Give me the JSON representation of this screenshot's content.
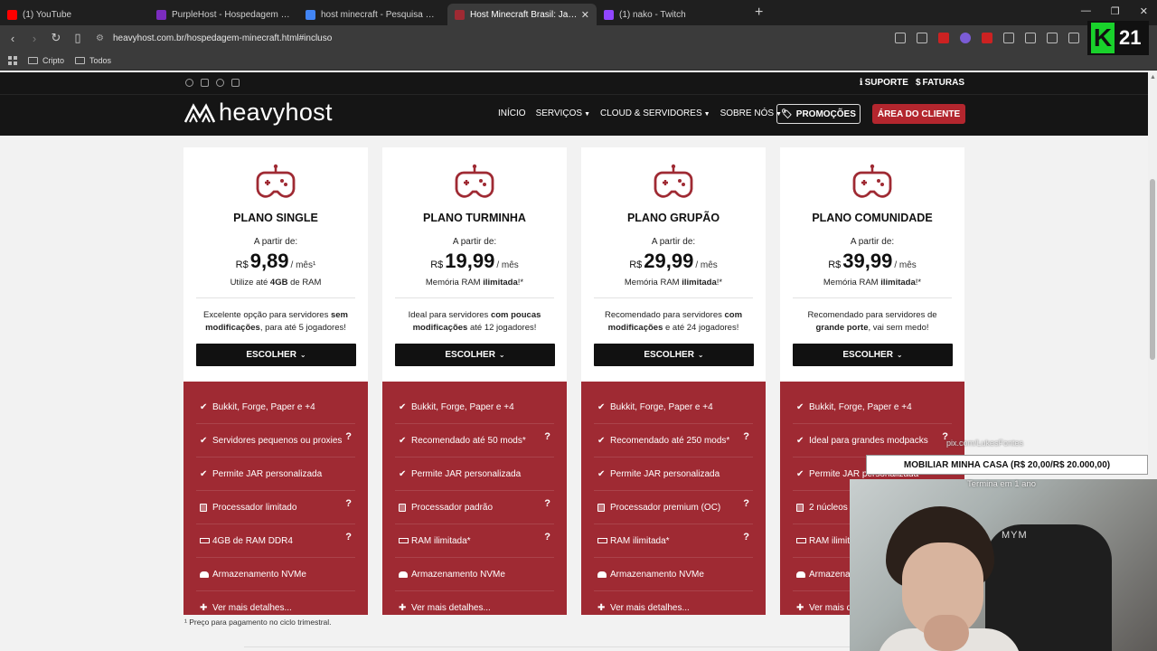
{
  "browser": {
    "tabs": [
      {
        "title": "(1) YouTube",
        "color": "#ff0000",
        "active": false
      },
      {
        "title": "PurpleHost - Hospedagem de Minecraft",
        "color": "#7b2cbf",
        "active": false
      },
      {
        "title": "host minecraft - Pesquisa Google",
        "color": "#4285f4",
        "active": false
      },
      {
        "title": "Host Minecraft Brasil: Java e Bedrock",
        "color": "#9f2a33",
        "active": true
      },
      {
        "title": "(1) nako - Twitch",
        "color": "#9146ff",
        "active": false
      }
    ],
    "new_tab": "+",
    "url": "heavyhost.com.br/hospedagem-minecraft.html#incluso",
    "bookmarks": [
      {
        "label": "Cripto"
      },
      {
        "label": "Todos"
      }
    ]
  },
  "site": {
    "top_links": [
      {
        "icon": "info-icon",
        "glyph": "ℹ",
        "label": "SUPORTE"
      },
      {
        "icon": "dollar-icon",
        "glyph": "$",
        "label": "FATURAS"
      }
    ],
    "logo_text": "heavyhost",
    "menu": [
      {
        "label": "INÍCIO",
        "caret": false
      },
      {
        "label": "SERVIÇOS",
        "caret": true
      },
      {
        "label": "CLOUD & SERVIDORES",
        "caret": true
      },
      {
        "label": "SOBRE NÓS",
        "caret": true
      }
    ],
    "promo_label": "PROMOÇÕES",
    "client_label": "ÁREA DO CLIENTE",
    "accent": "#9f2a33"
  },
  "plans": [
    {
      "name": "PLANO SINGLE",
      "from": "A partir de:",
      "currency": "R$",
      "price": "9,89",
      "per": "/ mês¹",
      "ram_pre": "Utilize até ",
      "ram_bold": "4GB",
      "ram_post": " de RAM",
      "desc_a": "Excelente opção para servidores ",
      "desc_b": "sem modificações",
      "desc_c": ", para até 5 jogadores!",
      "choose": "ESCOLHER",
      "features": [
        {
          "icon": "check",
          "text": "Bukkit, Forge, Paper e +4",
          "q": false
        },
        {
          "icon": "check",
          "text": "Servidores pequenos ou proxies",
          "q": true
        },
        {
          "icon": "check",
          "text": "Permite JAR personalizada",
          "q": false
        },
        {
          "icon": "cpu",
          "text": "Processador limitado",
          "q": true
        },
        {
          "icon": "ram",
          "text": "4GB de RAM DDR4",
          "q": true
        },
        {
          "icon": "disk",
          "text": "Armazenamento NVMe",
          "q": false
        },
        {
          "icon": "plus",
          "text": "Ver mais detalhes...",
          "q": false
        }
      ]
    },
    {
      "name": "PLANO TURMINHA",
      "from": "A partir de:",
      "currency": "R$",
      "price": "19,99",
      "per": "/ mês",
      "ram_pre": "Memória RAM ",
      "ram_bold": "ilimitada",
      "ram_post": "!*",
      "desc_a": "Ideal para servidores ",
      "desc_b": "com poucas modificações",
      "desc_c": " até 12 jogadores!",
      "choose": "ESCOLHER",
      "features": [
        {
          "icon": "check",
          "text": "Bukkit, Forge, Paper e +4",
          "q": false
        },
        {
          "icon": "check",
          "text": "Recomendado até 50 mods*",
          "q": true
        },
        {
          "icon": "check",
          "text": "Permite JAR personalizada",
          "q": false
        },
        {
          "icon": "cpu",
          "text": "Processador padrão",
          "q": true
        },
        {
          "icon": "ram",
          "text": "RAM ilimitada*",
          "q": true
        },
        {
          "icon": "disk",
          "text": "Armazenamento NVMe",
          "q": false
        },
        {
          "icon": "plus",
          "text": "Ver mais detalhes...",
          "q": false
        }
      ]
    },
    {
      "name": "PLANO GRUPÃO",
      "from": "A partir de:",
      "currency": "R$",
      "price": "29,99",
      "per": "/ mês",
      "ram_pre": "Memória RAM ",
      "ram_bold": "ilimitada",
      "ram_post": "!*",
      "desc_a": "Recomendado para servidores ",
      "desc_b": "com modificações",
      "desc_c": " e até 24 jogadores!",
      "choose": "ESCOLHER",
      "features": [
        {
          "icon": "check",
          "text": "Bukkit, Forge, Paper e +4",
          "q": false
        },
        {
          "icon": "check",
          "text": "Recomendado até 250 mods*",
          "q": true
        },
        {
          "icon": "check",
          "text": "Permite JAR personalizada",
          "q": false
        },
        {
          "icon": "cpu",
          "text": "Processador premium (OC)",
          "q": true
        },
        {
          "icon": "ram",
          "text": "RAM ilimitada*",
          "q": true
        },
        {
          "icon": "disk",
          "text": "Armazenamento NVMe",
          "q": false
        },
        {
          "icon": "plus",
          "text": "Ver mais detalhes...",
          "q": false
        }
      ]
    },
    {
      "name": "PLANO COMUNIDADE",
      "from": "A partir de:",
      "currency": "R$",
      "price": "39,99",
      "per": "/ mês",
      "ram_pre": "Memória RAM ",
      "ram_bold": "ilimitada",
      "ram_post": "!*",
      "desc_a": "Recomendado para servidores de ",
      "desc_b": "grande porte",
      "desc_c": ", vai sem medo!",
      "choose": "ESCOLHER",
      "features": [
        {
          "icon": "check",
          "text": "Bukkit, Forge, Paper e +4",
          "q": false
        },
        {
          "icon": "check",
          "text": "Ideal para grandes modpacks",
          "q": true
        },
        {
          "icon": "check",
          "text": "Permite JAR personalizada",
          "q": false
        },
        {
          "icon": "cpu",
          "text": "2 núcleos",
          "q": false
        },
        {
          "icon": "ram",
          "text": "RAM ilimitada*",
          "q": false
        },
        {
          "icon": "disk",
          "text": "Armazenamento NVMe",
          "q": false
        },
        {
          "icon": "plus",
          "text": "Ver mais detalhes...",
          "q": false
        }
      ]
    }
  ],
  "footnote": "¹ Preço para pagamento no ciclo trimestral.",
  "overlay": {
    "pix_text": "pix.com/LukesFontes",
    "goal_text": "MOBILIAR MINHA CASA (R$ 20,00/R$ 20.000,00)",
    "ends_text": "Termina em 1 ano",
    "badge_letter": "K",
    "badge_number": "21",
    "chair_text": "MYM"
  }
}
